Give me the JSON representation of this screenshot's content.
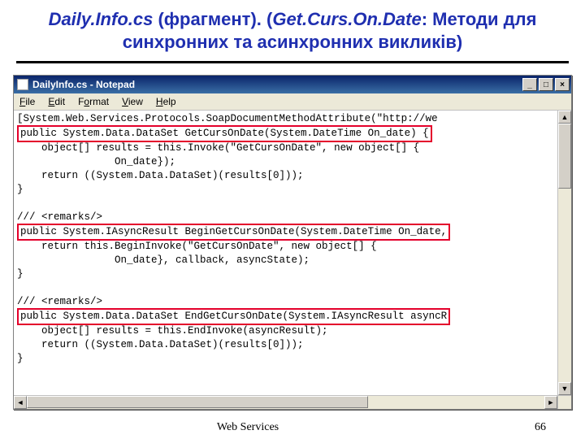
{
  "slide": {
    "title_part1_italic": "Daily.Info.cs",
    "title_part2": " (фрагмент). (",
    "title_part3_italic": "Get.Curs.On.Date",
    "title_part4": ": Методи для синхронних та асинхронних викликів)"
  },
  "notepad": {
    "titlebar": "DailyInfo.cs - Notepad",
    "window_buttons": {
      "minimize": "_",
      "maximize": "□",
      "close": "×"
    },
    "menu": {
      "file": "File",
      "edit": "Edit",
      "format": "Format",
      "view": "View",
      "help": "Help"
    },
    "code": {
      "l01": "[System.Web.Services.Protocols.SoapDocumentMethodAttribute(\"http://we",
      "l02": "public System.Data.DataSet GetCursOnDate(System.DateTime On_date) {",
      "l03": "    object[] results = this.Invoke(\"GetCursOnDate\", new object[] {",
      "l04": "                On_date});",
      "l05": "    return ((System.Data.DataSet)(results[0]));",
      "l06": "}",
      "l07": "",
      "l08": "/// <remarks/>",
      "l09": "public System.IAsyncResult BeginGetCursOnDate(System.DateTime On_date,",
      "l10": "    return this.BeginInvoke(\"GetCursOnDate\", new object[] {",
      "l11": "                On_date}, callback, asyncState);",
      "l12": "}",
      "l13": "",
      "l14": "/// <remarks/>",
      "l15": "public System.Data.DataSet EndGetCursOnDate(System.IAsyncResult asyncR",
      "l16": "    object[] results = this.EndInvoke(asyncResult);",
      "l17": "    return ((System.Data.DataSet)(results[0]));",
      "l18": "}"
    },
    "scroll": {
      "up": "▲",
      "down": "▼",
      "left": "◄",
      "right": "►"
    }
  },
  "footer": {
    "center": "Web Services",
    "right": "66"
  }
}
